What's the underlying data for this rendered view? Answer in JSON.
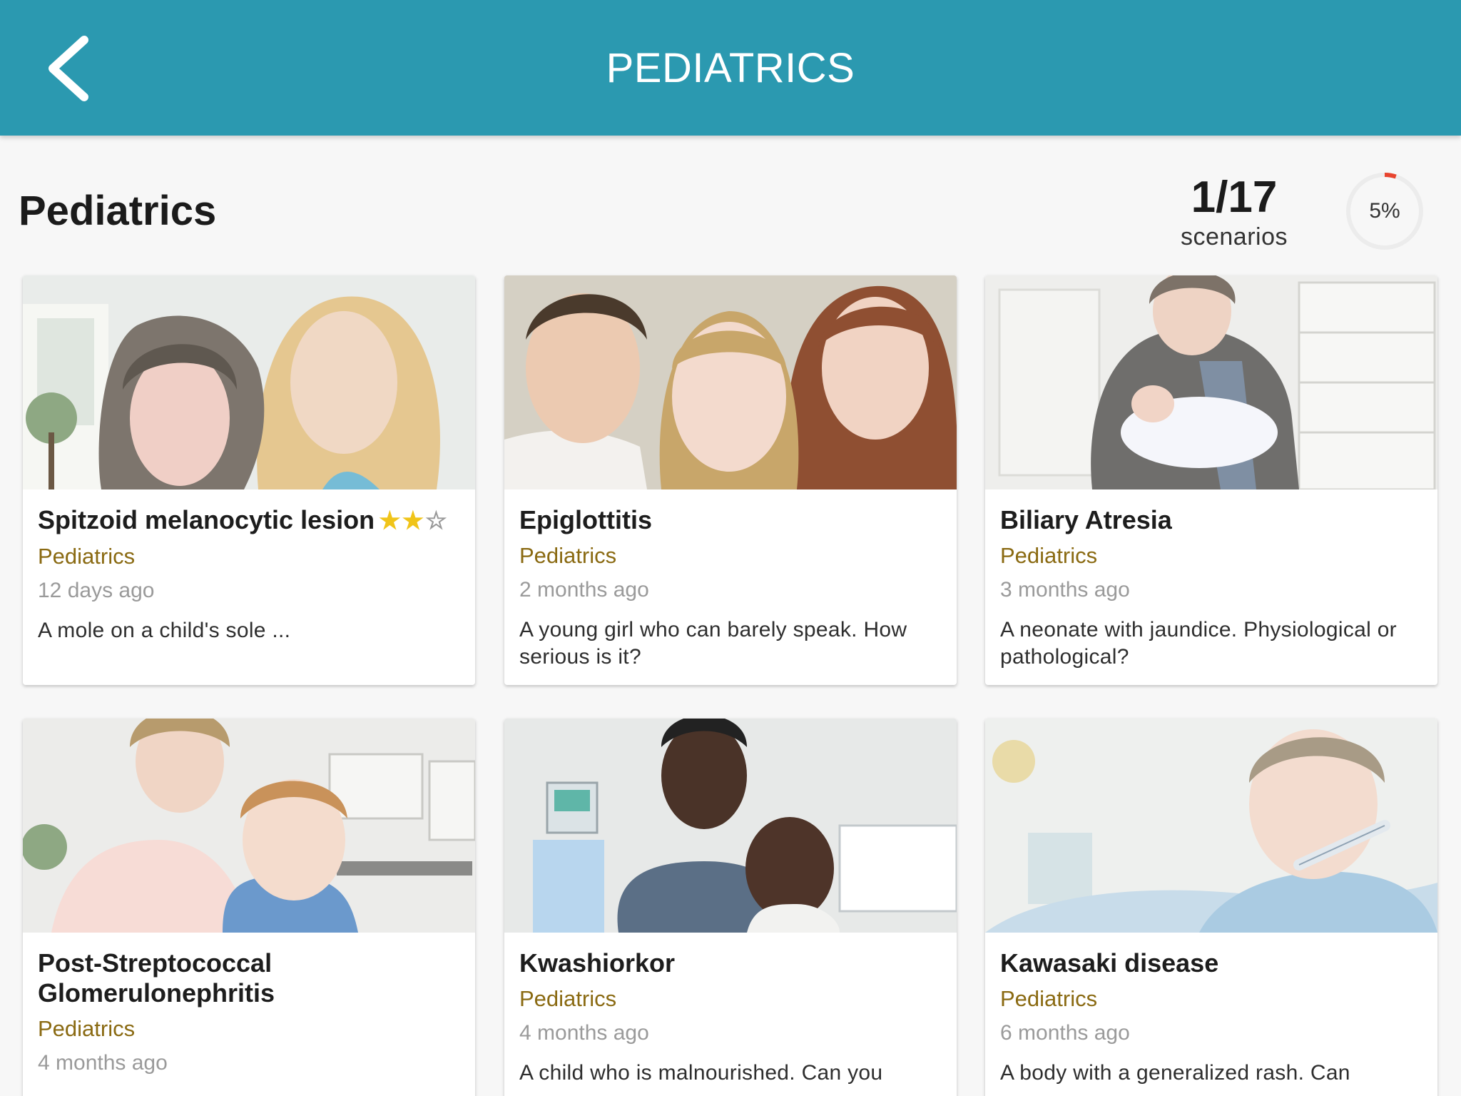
{
  "header": {
    "title": "PEDIATRICS",
    "back_icon": "chevron-left-icon",
    "background_color": "#2b99b0"
  },
  "summary": {
    "section_title": "Pediatrics",
    "completed": "1/17",
    "completed_label": "scenarios",
    "progress_label": "5%",
    "progress_fraction": 0.05,
    "progress_color": "#e8442e"
  },
  "cards": [
    {
      "title": "Spitzoid melanocytic lesion",
      "rating_filled": "★★",
      "rating_empty": "☆",
      "category": "Pediatrics",
      "date": "12 days ago",
      "description": "A mole on a child's sole ..."
    },
    {
      "title": "Epiglottitis",
      "category": "Pediatrics",
      "date": "2 months ago",
      "description": "A young girl who can barely speak. How serious is it?"
    },
    {
      "title": "Biliary Atresia",
      "category": "Pediatrics",
      "date": "3 months ago",
      "description": "A neonate with jaundice. Physiological or pathological?"
    },
    {
      "title": "Post-Streptococcal Glomerulonephritis",
      "category": "Pediatrics",
      "date": "4 months ago",
      "description": ""
    },
    {
      "title": "Kwashiorkor",
      "category": "Pediatrics",
      "date": "4 months ago",
      "description": "A child who is malnourished. Can you"
    },
    {
      "title": "Kawasaki disease",
      "category": "Pediatrics",
      "date": "6 months ago",
      "description": "A body with a generalized rash. Can"
    }
  ]
}
